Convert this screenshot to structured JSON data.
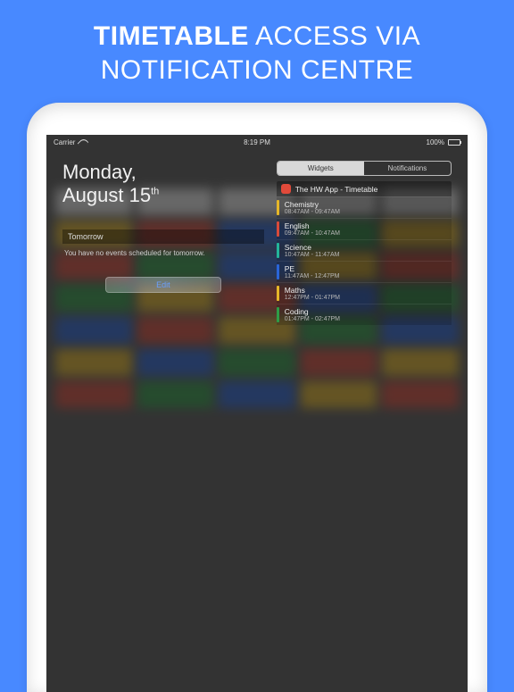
{
  "promo": {
    "line1_bold": "TIMETABLE",
    "line1_rest": " ACCESS VIA",
    "line2": "NOTIFICATION CENTRE"
  },
  "status": {
    "carrier": "Carrier",
    "time": "8:19 PM",
    "battery": "100%"
  },
  "date": {
    "weekday": "Monday,",
    "month_day": "August 15",
    "ordinal": "th"
  },
  "tomorrow": {
    "label": "Tomorrow",
    "empty_text": "You have no events scheduled for tomorrow."
  },
  "edit_label": "Edit",
  "segments": {
    "widgets": "Widgets",
    "notifications": "Notifications"
  },
  "widget": {
    "title": "The HW App - Timetable",
    "classes": [
      {
        "name": "Chemistry",
        "time": "08:47AM - 09:47AM",
        "color": "#e6b728"
      },
      {
        "name": "English",
        "time": "09:47AM - 10:47AM",
        "color": "#d84a3a"
      },
      {
        "name": "Science",
        "time": "10:47AM - 11:47AM",
        "color": "#23b49a"
      },
      {
        "name": "PE",
        "time": "11:47AM - 12:47PM",
        "color": "#2a65d8"
      },
      {
        "name": "Maths",
        "time": "12:47PM - 01:47PM",
        "color": "#e6b728"
      },
      {
        "name": "Coding",
        "time": "01:47PM - 02:47PM",
        "color": "#2e9c47"
      }
    ]
  }
}
